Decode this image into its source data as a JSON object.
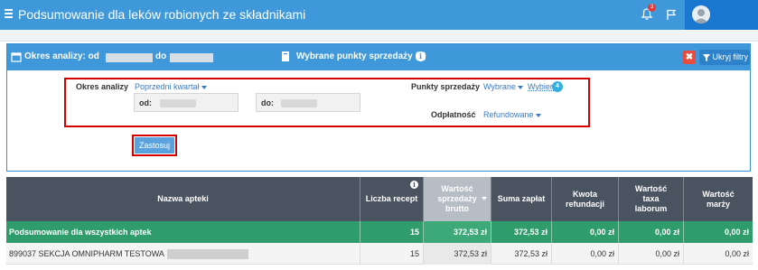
{
  "header": {
    "title": "Podsumowanie dla leków robionych ze składnikami",
    "notifications_count": "3",
    "icons": [
      "menu-icon",
      "bell-icon",
      "flag-icon",
      "user-avatar-icon"
    ]
  },
  "filter_panel": {
    "period_label": "Okres analizy: od",
    "period_to": "do",
    "points_label": "Wybrane punkty sprzedaży (4)",
    "hide_filters": "Ukryj filtry",
    "close_symbol": "✖",
    "info_symbol": "i",
    "accent_color": "#3f98d9"
  },
  "filters": {
    "okres_label": "Okres analizy",
    "okres_value": "Poprzedni kwartał",
    "from_label": "od:",
    "to_label": "do:",
    "punkty_label": "Punkty sprzedaży",
    "punkty_value": "Wybrane",
    "wybierz_link": "Wybierz",
    "wybierz_count": "4",
    "odplatnosc_label": "Odpłatność",
    "odplatnosc_value": "Refundowane",
    "apply_label": "Zastosuj"
  },
  "table": {
    "columns": [
      "Nazwa apteki",
      "Liczba recept",
      "Wartość sprzedaży brutto",
      "Suma zapłat",
      "Kwota refundacji",
      "Wartość taxa laborum",
      "Wartość marży"
    ],
    "summary_row": {
      "name": "Podsumowanie dla wszystkich aptek",
      "cells": [
        "15",
        "372,53 zł",
        "372,53 zł",
        "0,00 zł",
        "0,00 zł",
        "0,00 zł"
      ]
    },
    "rows": [
      {
        "name": "899037 SEKCJA OMNIPHARM TESTOWA",
        "cells": [
          "15",
          "372,53 zł",
          "372,53 zł",
          "0,00 zł",
          "0,00 zł",
          "0,00 zł"
        ]
      }
    ]
  }
}
